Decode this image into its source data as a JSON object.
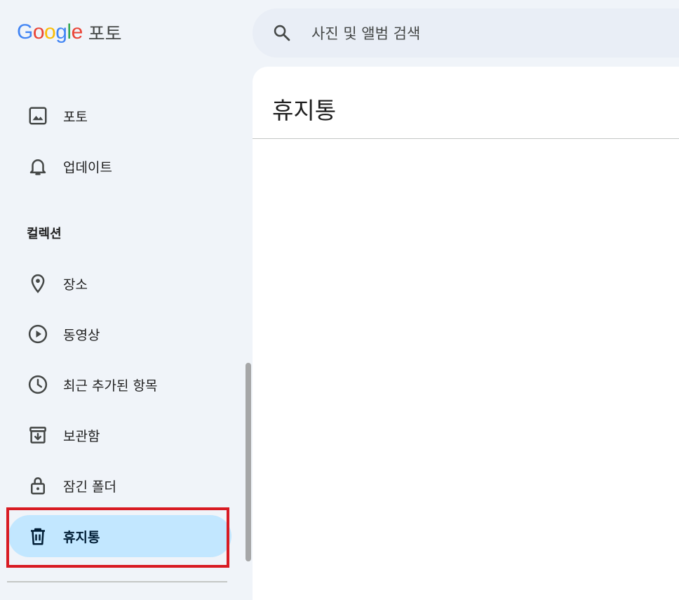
{
  "header": {
    "logo_letters": [
      {
        "char": "G",
        "color": "#4285F4"
      },
      {
        "char": "o",
        "color": "#EA4335"
      },
      {
        "char": "o",
        "color": "#FBBC05"
      },
      {
        "char": "g",
        "color": "#4285F4"
      },
      {
        "char": "l",
        "color": "#34A853"
      },
      {
        "char": "e",
        "color": "#EA4335"
      }
    ],
    "product_name": "포토",
    "search": {
      "icon": "search-icon",
      "placeholder": "사진 및 앨범 검색"
    }
  },
  "sidebar": {
    "items": [
      {
        "label": "포토",
        "icon": "photo-icon"
      },
      {
        "label": "업데이트",
        "icon": "bell-icon"
      }
    ],
    "collections_title": "컬렉션",
    "collections": [
      {
        "label": "장소",
        "icon": "location-pin-icon"
      },
      {
        "label": "동영상",
        "icon": "play-circle-icon"
      },
      {
        "label": "최근 추가된 항목",
        "icon": "clock-icon"
      },
      {
        "label": "보관함",
        "icon": "archive-icon"
      },
      {
        "label": "잠긴 폴더",
        "icon": "lock-icon"
      },
      {
        "label": "휴지통",
        "icon": "trash-icon",
        "selected": true
      }
    ]
  },
  "main": {
    "title": "휴지통"
  },
  "colors": {
    "background": "#f0f4f9",
    "search_bg": "#e9eef6",
    "active_bg": "#c2e7ff",
    "highlight_border": "#d81b23"
  }
}
